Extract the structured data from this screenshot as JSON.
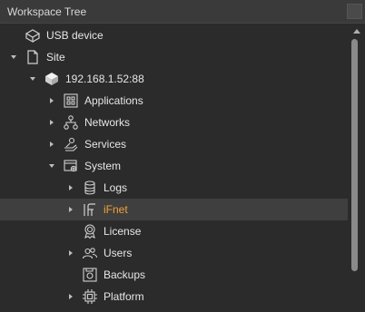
{
  "panel": {
    "title": "Workspace Tree"
  },
  "tree": {
    "items": [
      {
        "label": "USB device",
        "icon": "usb-device-icon",
        "expanded": null,
        "selected": false
      },
      {
        "label": "Site",
        "icon": "document-icon",
        "expanded": true,
        "selected": false
      },
      {
        "label": "192.168.1.52:88",
        "icon": "server-icon",
        "expanded": true,
        "selected": false
      },
      {
        "label": "Applications",
        "icon": "applications-icon",
        "expanded": false,
        "selected": false
      },
      {
        "label": "Networks",
        "icon": "network-icon",
        "expanded": false,
        "selected": false
      },
      {
        "label": "Services",
        "icon": "services-icon",
        "expanded": false,
        "selected": false
      },
      {
        "label": "System",
        "icon": "system-icon",
        "expanded": true,
        "selected": false
      },
      {
        "label": "Logs",
        "icon": "database-icon",
        "expanded": false,
        "selected": false
      },
      {
        "label": "iFnet",
        "icon": "ifnet-icon",
        "expanded": false,
        "selected": true
      },
      {
        "label": "License",
        "icon": "license-icon",
        "expanded": null,
        "selected": false
      },
      {
        "label": "Users",
        "icon": "users-icon",
        "expanded": false,
        "selected": false
      },
      {
        "label": "Backups",
        "icon": "backups-icon",
        "expanded": null,
        "selected": false
      },
      {
        "label": "Platform",
        "icon": "chip-icon",
        "expanded": false,
        "selected": false
      }
    ]
  },
  "colors": {
    "background": "#2b2b2b",
    "selected_row": "#3f3f3f",
    "active_text": "#f0a13a",
    "text": "#e6e6e6"
  }
}
